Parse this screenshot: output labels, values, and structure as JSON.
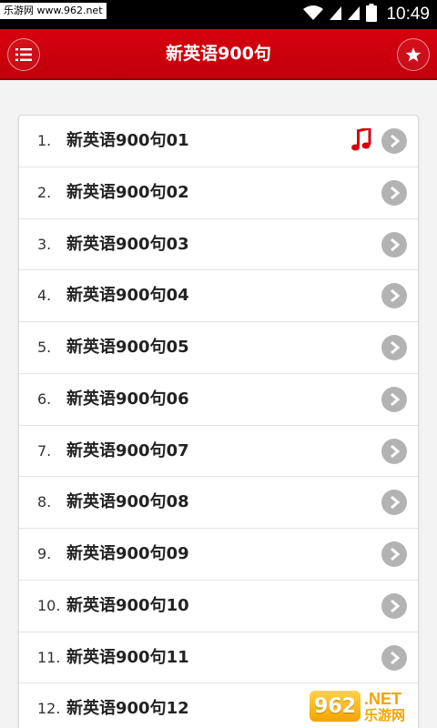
{
  "status_bar": {
    "watermark": "乐游网 www.962.net",
    "time": "10:49",
    "icons": [
      "wifi-icon",
      "signal-icon",
      "signal-icon",
      "battery-icon"
    ]
  },
  "app_bar": {
    "title": "新英语900句",
    "left_icon": "list-menu-icon",
    "right_icon": "star-icon",
    "color": "#d6000e"
  },
  "lessons": [
    {
      "num": "1.",
      "title": "新英语900句01",
      "playing": true
    },
    {
      "num": "2.",
      "title": "新英语900句02",
      "playing": false
    },
    {
      "num": "3.",
      "title": "新英语900句03",
      "playing": false
    },
    {
      "num": "4.",
      "title": "新英语900句04",
      "playing": false
    },
    {
      "num": "5.",
      "title": "新英语900句05",
      "playing": false
    },
    {
      "num": "6.",
      "title": "新英语900句06",
      "playing": false
    },
    {
      "num": "7.",
      "title": "新英语900句07",
      "playing": false
    },
    {
      "num": "8.",
      "title": "新英语900句08",
      "playing": false
    },
    {
      "num": "9.",
      "title": "新英语900句09",
      "playing": false
    },
    {
      "num": "10.",
      "title": "新英语900句10",
      "playing": false
    },
    {
      "num": "11.",
      "title": "新英语900句11",
      "playing": false
    },
    {
      "num": "12.",
      "title": "新英语900句12",
      "playing": false
    }
  ],
  "watermark_logo": {
    "mark": "962",
    "net": ".NET",
    "text": "乐游网"
  }
}
